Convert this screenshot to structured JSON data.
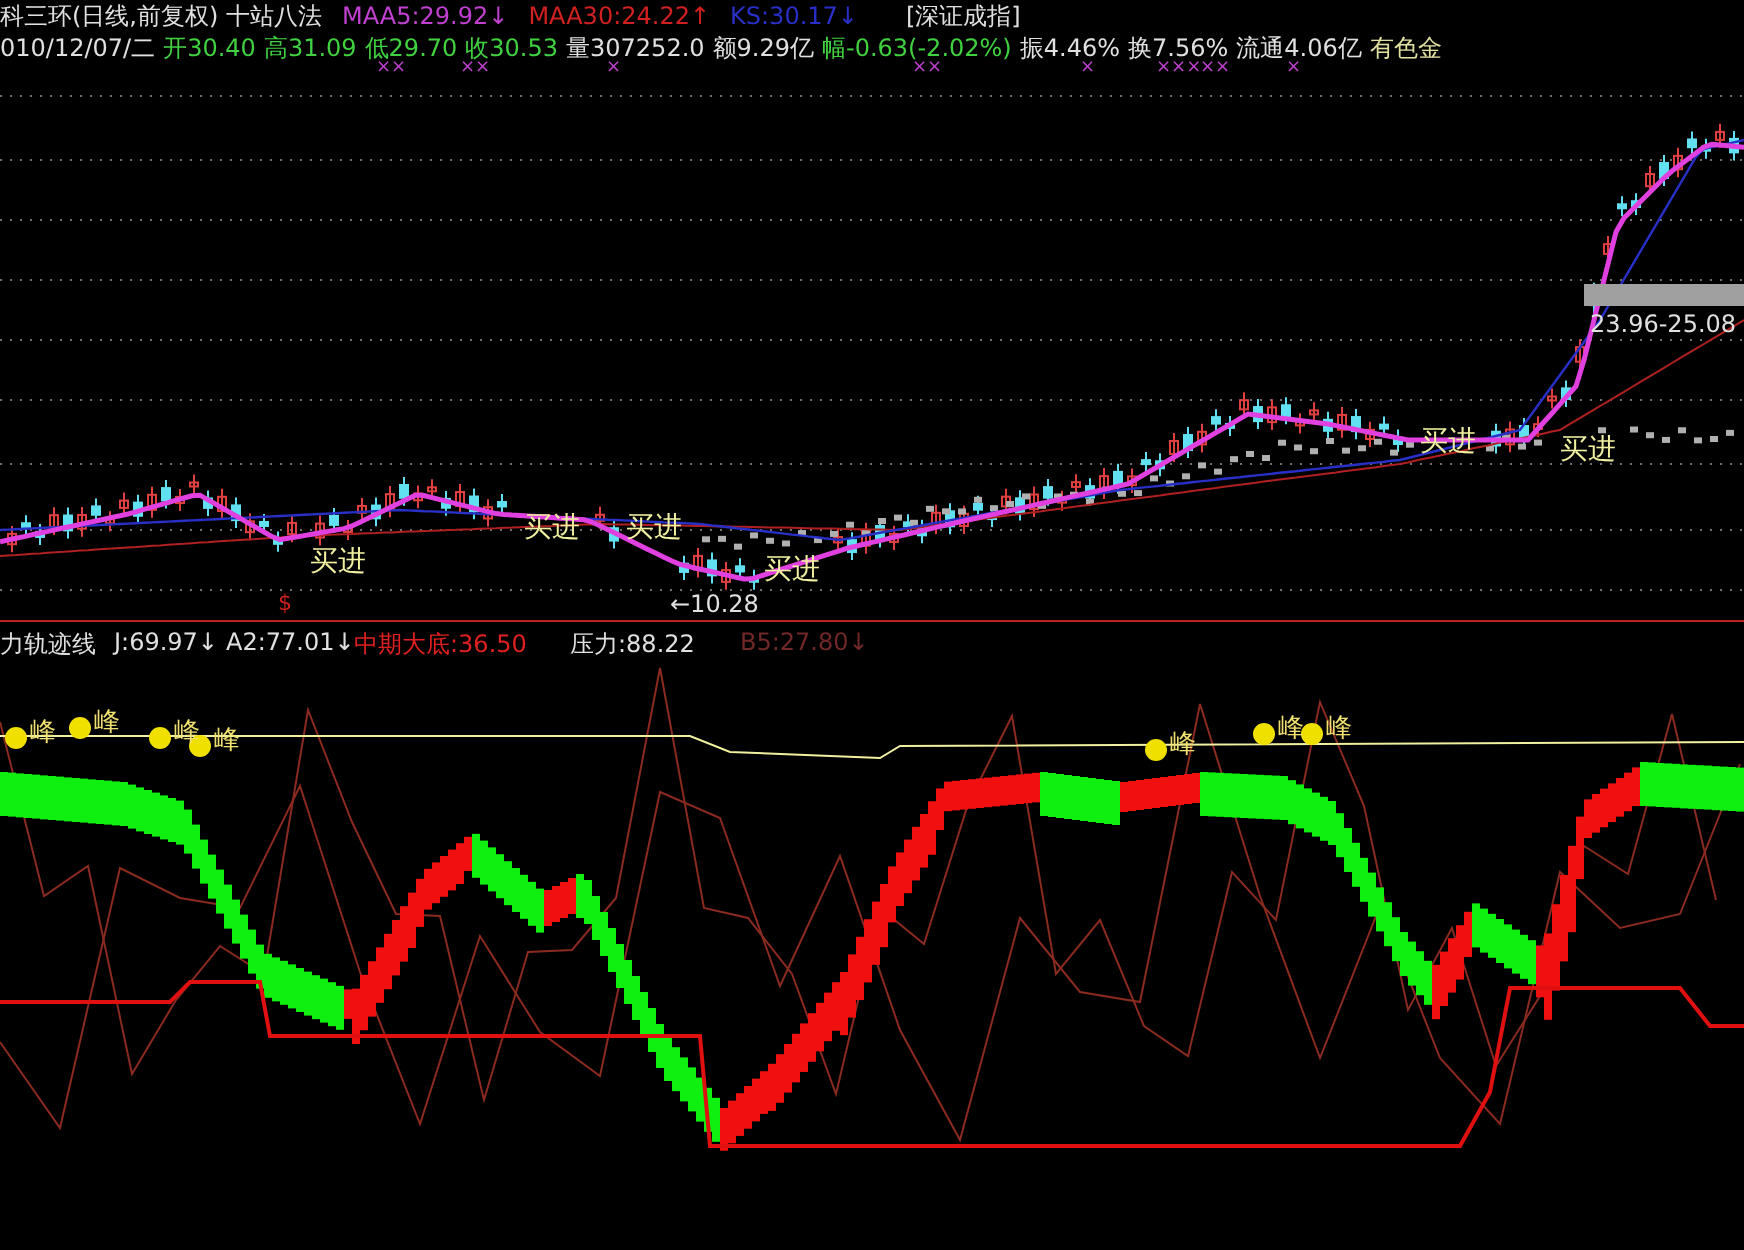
{
  "quote_header": {
    "title": "科三环(日线,前复权) 十站八法",
    "indicators": [
      {
        "text": "MAA5:29.92↓",
        "color": "#c040d0"
      },
      {
        "text": "MAA30:24.22↑",
        "color": "#d02020"
      },
      {
        "text": "KS:30.17↓",
        "color": "#2830c8"
      }
    ],
    "index_name": "[深证成指]"
  },
  "quote_line": [
    {
      "text": "010/12/07/二",
      "color": "#e0e0e0"
    },
    {
      "text": "开30.40",
      "color": "#40d040"
    },
    {
      "text": "高31.09",
      "color": "#40d040"
    },
    {
      "text": "低29.70",
      "color": "#40d040"
    },
    {
      "text": "收30.53",
      "color": "#40d040"
    },
    {
      "text": "量307252.0",
      "color": "#e0e0e0"
    },
    {
      "text": "额9.29亿",
      "color": "#e0e0e0"
    },
    {
      "text": "幅-0.63(-2.02%)",
      "color": "#40d040"
    },
    {
      "text": "振4.46%",
      "color": "#e0e0e0"
    },
    {
      "text": "换7.56%",
      "color": "#e0e0e0"
    },
    {
      "text": "流通4.06亿",
      "color": "#e0e0e0"
    },
    {
      "text": "有色金",
      "color": "#e0e0a0"
    }
  ],
  "marks": [
    "××",
    "××",
    "×",
    "××",
    "×",
    "×××",
    "××",
    "×"
  ],
  "price_chart": {
    "buy_signals": [
      "买进",
      "买进",
      "买进",
      "买进",
      "买进",
      "买进"
    ],
    "low_label": "←10.28",
    "range_label": "23.96-25.08",
    "signal_mark": "$"
  },
  "indicator_header": [
    {
      "text": "力轨迹线",
      "color": "#e0e0e0"
    },
    {
      "text": "J:69.97↓",
      "color": "#e0e0e0"
    },
    {
      "text": "A2:77.01↓",
      "color": "#e0e0e0"
    },
    {
      "text": "中期大底:36.50",
      "color": "#e02020"
    },
    {
      "text": "压力:88.22",
      "color": "#e0e0e0"
    },
    {
      "text": "B5:27.80↓",
      "color": "#702828"
    }
  ],
  "peak_labels": [
    "峰",
    "峰",
    "峰",
    "峰",
    "峰",
    "峰",
    "峰"
  ]
}
